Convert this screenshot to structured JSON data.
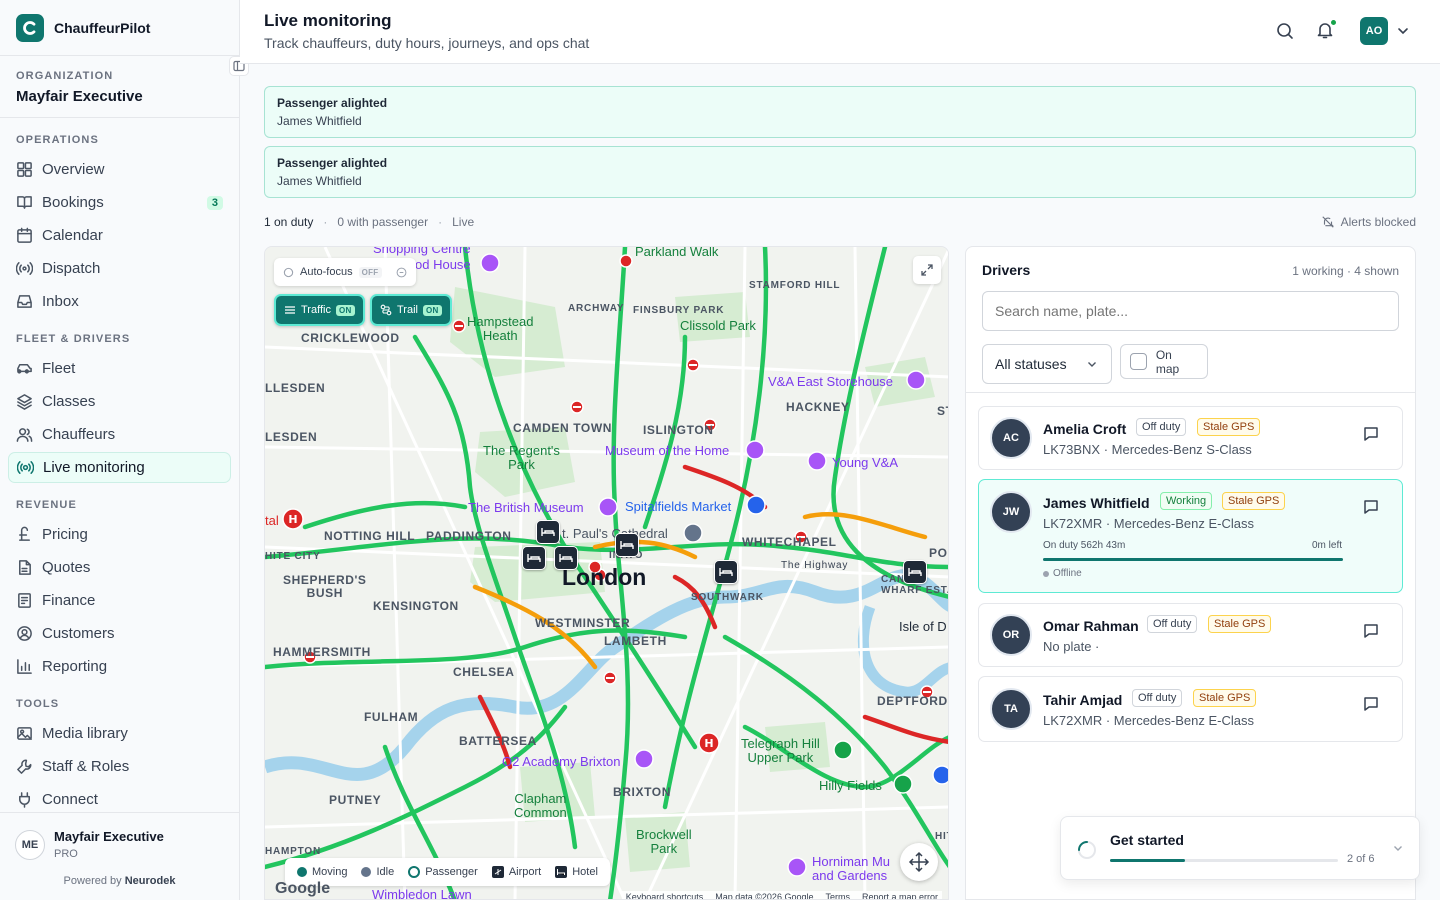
{
  "app": {
    "name": "ChauffeurPilot"
  },
  "organization": {
    "label": "ORGANIZATION",
    "name": "Mayfair Executive"
  },
  "nav": [
    {
      "label": "OPERATIONS",
      "items": [
        {
          "label": "Overview",
          "icon": "grid-icon"
        },
        {
          "label": "Bookings",
          "icon": "book-icon",
          "badge": "3"
        },
        {
          "label": "Calendar",
          "icon": "calendar-icon"
        },
        {
          "label": "Dispatch",
          "icon": "broadcast-icon"
        },
        {
          "label": "Inbox",
          "icon": "inbox-icon"
        }
      ]
    },
    {
      "label": "FLEET & DRIVERS",
      "items": [
        {
          "label": "Fleet",
          "icon": "car-icon"
        },
        {
          "label": "Classes",
          "icon": "layers-icon"
        },
        {
          "label": "Chauffeurs",
          "icon": "users-icon"
        },
        {
          "label": "Live monitoring",
          "icon": "radio-icon",
          "active": true
        }
      ]
    },
    {
      "label": "REVENUE",
      "items": [
        {
          "label": "Pricing",
          "icon": "pound-icon"
        },
        {
          "label": "Quotes",
          "icon": "file-icon"
        },
        {
          "label": "Finance",
          "icon": "receipt-icon"
        },
        {
          "label": "Customers",
          "icon": "user-circle-icon"
        },
        {
          "label": "Reporting",
          "icon": "chart-icon"
        }
      ]
    },
    {
      "label": "TOOLS",
      "items": [
        {
          "label": "Media library",
          "icon": "image-icon"
        },
        {
          "label": "Staff & Roles",
          "icon": "wrench-icon"
        },
        {
          "label": "Connect",
          "icon": "plug-icon"
        }
      ]
    }
  ],
  "footer": {
    "initials": "ME",
    "name": "Mayfair Executive",
    "plan": "PRO",
    "powered_prefix": "Powered by",
    "powered_brand": "Neurodek"
  },
  "header": {
    "title": "Live monitoring",
    "subtitle": "Track chauffeurs, duty hours, journeys, and ops chat",
    "avatar": "AO"
  },
  "alerts": [
    {
      "title": "Passenger alighted",
      "body": "James Whitfield"
    },
    {
      "title": "Passenger alighted",
      "body": "James Whitfield"
    }
  ],
  "status": {
    "on_duty": "1 on duty",
    "with_passenger": "0 with passenger",
    "live": "Live",
    "alerts_blocked": "Alerts blocked"
  },
  "map": {
    "autofocus": {
      "label": "Auto-focus",
      "state": "OFF"
    },
    "traffic": {
      "label": "Traffic",
      "state": "ON"
    },
    "trail": {
      "label": "Trail",
      "state": "ON"
    },
    "legend": [
      "Moving",
      "Idle",
      "Passenger",
      "Airport",
      "Hotel"
    ],
    "legend_colors": {
      "moving": "#0f766e",
      "idle": "#64748b"
    },
    "google": "Google",
    "attribution": [
      "Keyboard shortcuts",
      "Map data ©2026 Google",
      "Terms",
      "Report a map error"
    ],
    "labels": {
      "london": "London",
      "crickle": "CRICKLEWOOD",
      "archway": "ARCHWAY",
      "finsbury": "FINSBURY PARK",
      "stamford": "STAMFORD HILL",
      "hackney": "HACKNEY",
      "camden": "CAMDEN TOWN",
      "islington": "ISLINGTON",
      "notting": "NOTTING HILL",
      "paddington": "PADDINGTON",
      "whitechapel": "WHITECHAPEL",
      "shepherds": "SHEPHERD'S\nBUSH",
      "kensington": "KENSINGTON",
      "westminster": "WESTMINSTER",
      "lambeth": "LAMBETH",
      "southwark": "SOUTHWARK",
      "chelsea": "CHELSEA",
      "fulham": "FULHAM",
      "battersea": "BATTERSEA",
      "brixton": "BRIXTON",
      "putney": "PUTNEY",
      "deptford": "DEPTFORD",
      "hammersmith": "HAMMERSMITH",
      "willesden": "LLESDEN",
      "kesden": "LESDEN",
      "whitecity": "HITE CITY",
      "isle": "Isle of D",
      "canary": "CAN\nWHARF ESTATE",
      "hampstead": "Hampstead\nHeath",
      "clissold": "Clissold Park",
      "regents": "The Regent's\nPark",
      "museumhome": "Museum of the Home",
      "va_east": "V&A East Storehouse",
      "youngva": "Young V&A",
      "britmus": "The British Museum",
      "spitalfields": "Spitalfields Market",
      "stpauls": "t. Paul's Cathedral",
      "o2": "O2 Academy Brixton",
      "telegraph": "Telegraph Hill\nUpper Park",
      "hilly": "Hilly Fields",
      "clapham": "Clapham\nCommon",
      "brockwell": "Brockwell\nPark",
      "horniman": "Horniman Mu\nand Gardens",
      "parkland": "Parkland Walk",
      "shopping": "Shopping Centre",
      "odhouse": "od House",
      "hampton": "HAMPTON",
      "wimbledon": "Wimbledon Lawn",
      "highway": "The Highway",
      "tal": "tal",
      "innato": "INATO",
      "hit": "HIT",
      "st": "ST",
      "poi": "POI"
    }
  },
  "drivers": {
    "title": "Drivers",
    "meta": "1 working · 4 shown",
    "search_placeholder": "Search name, plate...",
    "status_filter": "All statuses",
    "on_map_label": "On map",
    "list": [
      {
        "initials": "AC",
        "name": "Amelia Croft",
        "status": "Off duty",
        "gps": "Stale GPS",
        "detail": "LK73BNX · Mercedes-Benz S-Class"
      },
      {
        "initials": "JW",
        "name": "James Whitfield",
        "status": "Working",
        "gps": "Stale GPS",
        "detail": "LK72XMR · Mercedes-Benz E-Class",
        "duty": "On duty 562h 43m",
        "left": "0m left",
        "connection": "Offline"
      },
      {
        "initials": "OR",
        "name": "Omar Rahman",
        "status": "Off duty",
        "gps": "Stale GPS",
        "detail": "No plate ·"
      },
      {
        "initials": "TA",
        "name": "Tahir Amjad",
        "status": "Off duty",
        "gps": "Stale GPS",
        "detail": "LK72XMR · Mercedes-Benz E-Class"
      }
    ]
  },
  "get_started": {
    "title": "Get started",
    "step": "2 of 6",
    "progress": 0.33
  }
}
